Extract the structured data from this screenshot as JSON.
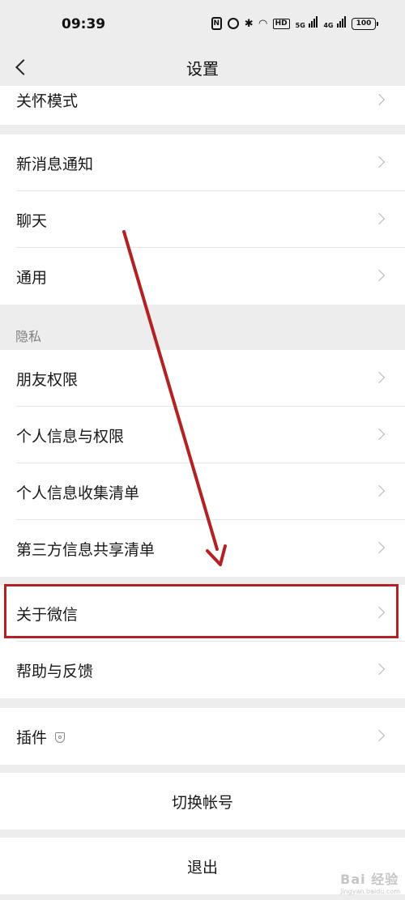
{
  "status": {
    "time": "09:39",
    "nfc": "N",
    "hd": "HD",
    "sig1": "5G",
    "sig2": "4G",
    "battery": "100"
  },
  "nav": {
    "title": "设置"
  },
  "groups": {
    "care": "关怀模式",
    "notify": "新消息通知",
    "chat": "聊天",
    "general": "通用"
  },
  "privacy": {
    "header": "隐私",
    "items": [
      "朋友权限",
      "个人信息与权限",
      "个人信息收集清单",
      "第三方信息共享清单"
    ]
  },
  "about": {
    "items": [
      "关于微信",
      "帮助与反馈"
    ]
  },
  "plugins": {
    "label": "插件"
  },
  "actions": {
    "switch_account": "切换帐号",
    "logout": "退出"
  },
  "annotation": {
    "color": "#b32222"
  },
  "watermark": {
    "text": "Bai 经验",
    "sub": "jingyan.baidu.com"
  }
}
